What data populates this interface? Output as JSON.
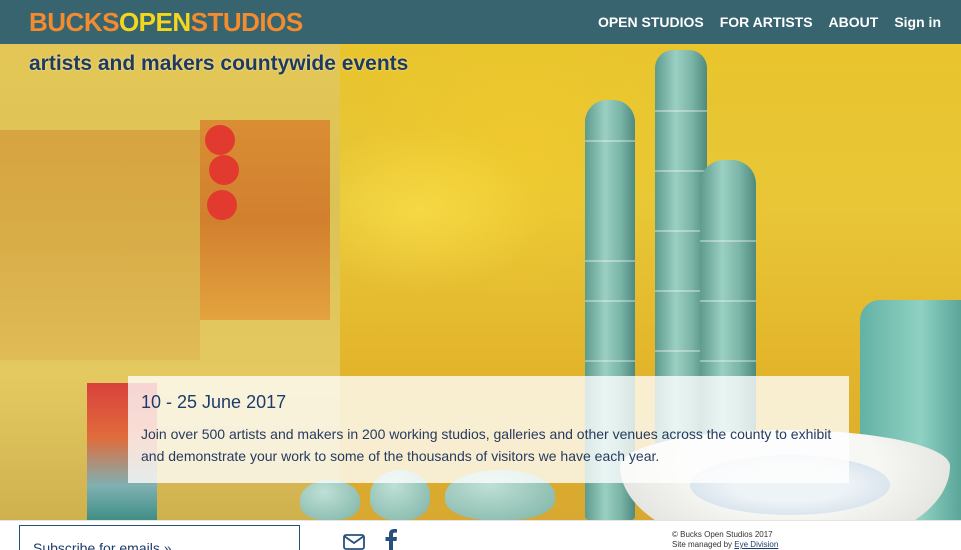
{
  "header": {
    "logo": {
      "part1": "BUCKS",
      "part2": "OPEN",
      "part3": "STUDIOS"
    },
    "nav": [
      {
        "label": "OPEN STUDIOS"
      },
      {
        "label": "FOR ARTISTS"
      },
      {
        "label": "ABOUT"
      },
      {
        "label": "Sign in"
      }
    ]
  },
  "hero": {
    "tagline": "artists and makers countywide events"
  },
  "infobox": {
    "dates": "10 - 25 June 2017",
    "description": "Join over 500 artists and makers in 200 working studios, galleries and other venues across the county to exhibit and demonstrate your work to some of the thousands of visitors we have each year."
  },
  "footer": {
    "subscribe_label": "Subscribe for emails »",
    "icons": [
      "mail-icon",
      "facebook-icon"
    ],
    "copyright": "© Bucks Open Studios 2017",
    "managed_prefix": "Site managed by",
    "managed_link": "Eye Division"
  },
  "colors": {
    "topbar": "#1f577a",
    "logo_orange": "#f28c2e",
    "logo_yellow": "#f4d61e",
    "text_navy": "#1d3c6a"
  }
}
